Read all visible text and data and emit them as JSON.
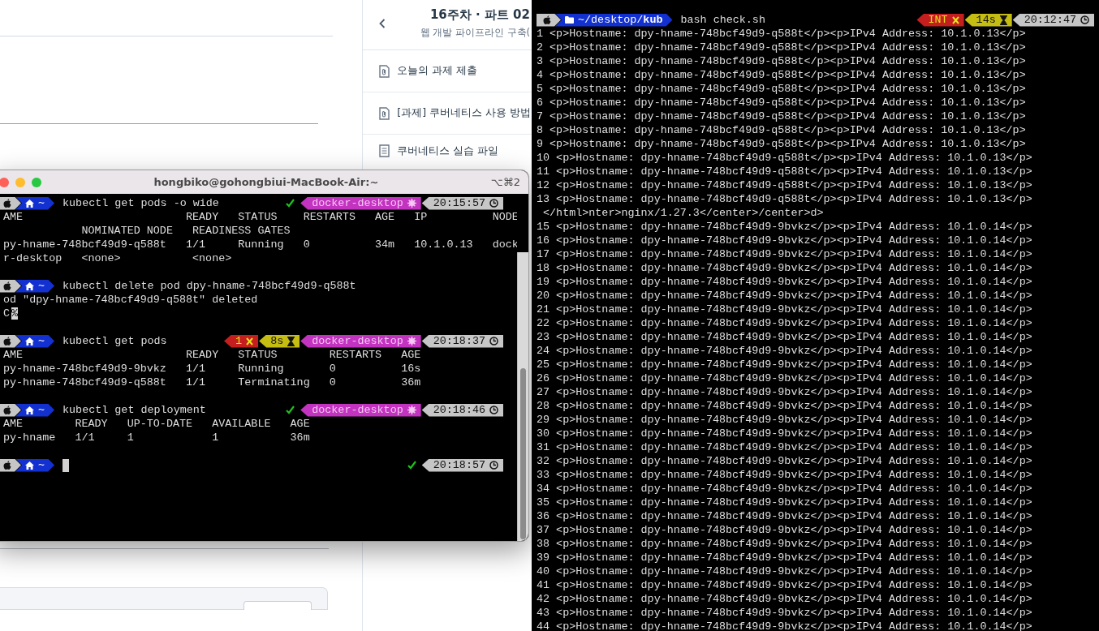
{
  "course_panel": {
    "title": "16주차 · 파트 02",
    "subtitle": "웹 개발 파이프라인 구축(",
    "items": [
      {
        "kind": "attachment",
        "label": "오늘의 과제 제출"
      },
      {
        "kind": "attachment",
        "label": "[과제] 쿠버네티스 사용 방법"
      },
      {
        "kind": "document",
        "label": "쿠버네티스 실습 파일"
      }
    ]
  },
  "terminal_left": {
    "title": "hongbiko@gohongbiui-MacBook-Air:~",
    "shortcut": "⌥⌘2",
    "lines": [
      {
        "kind": "prompt",
        "left": [
          {
            "kind": "apple"
          },
          {
            "kind": "home",
            "path": "~"
          }
        ],
        "command": "kubectl get pods -o wide",
        "cursor": false,
        "right": [
          {
            "kind": "ok"
          },
          {
            "kind": "context",
            "text": "docker-desktop"
          },
          {
            "kind": "time",
            "text": "20:15:57"
          }
        ]
      },
      {
        "kind": "text",
        "text": "AME                         READY   STATUS    RESTARTS   AGE   IP          NODE"
      },
      {
        "kind": "text",
        "text": "            NOMINATED NODE   READINESS GATES"
      },
      {
        "kind": "text",
        "text": "py-hname-748bcf49d9-q588t   1/1     Running   0          34m   10.1.0.13   dock"
      },
      {
        "kind": "text",
        "text": "r-desktop   <none>           <none>"
      },
      {
        "kind": "blank"
      },
      {
        "kind": "prompt",
        "left": [
          {
            "kind": "apple"
          },
          {
            "kind": "home",
            "path": "~"
          }
        ],
        "command": "kubectl delete pod dpy-hname-748bcf49d9-q588t",
        "cursor": false
      },
      {
        "kind": "text",
        "text": "od \"dpy-hname-748bcf49d9-q588t\" deleted"
      },
      {
        "kind": "text",
        "text": "C",
        "marker": "%"
      },
      {
        "kind": "blank"
      },
      {
        "kind": "prompt",
        "left": [
          {
            "kind": "apple"
          },
          {
            "kind": "home",
            "path": "~"
          }
        ],
        "command": "kubectl get pods",
        "cursor": false,
        "right": [
          {
            "kind": "error",
            "text": "1"
          },
          {
            "kind": "duration",
            "text": "8s"
          },
          {
            "kind": "context",
            "text": "docker-desktop"
          },
          {
            "kind": "time",
            "text": "20:18:37"
          }
        ]
      },
      {
        "kind": "text",
        "text": "AME                         READY   STATUS        RESTARTS   AGE"
      },
      {
        "kind": "text",
        "text": "py-hname-748bcf49d9-9bvkz   1/1     Running       0          16s"
      },
      {
        "kind": "text",
        "text": "py-hname-748bcf49d9-q588t   1/1     Terminating   0          36m"
      },
      {
        "kind": "blank"
      },
      {
        "kind": "prompt",
        "left": [
          {
            "kind": "apple"
          },
          {
            "kind": "home",
            "path": "~"
          }
        ],
        "command": "kubectl get deployment",
        "cursor": false,
        "right": [
          {
            "kind": "ok"
          },
          {
            "kind": "context",
            "text": "docker-desktop"
          },
          {
            "kind": "time",
            "text": "20:18:46"
          }
        ]
      },
      {
        "kind": "text",
        "text": "AME        READY   UP-TO-DATE   AVAILABLE   AGE"
      },
      {
        "kind": "text",
        "text": "py-hname   1/1     1            1           36m"
      },
      {
        "kind": "blank"
      },
      {
        "kind": "prompt",
        "left": [
          {
            "kind": "apple"
          },
          {
            "kind": "home",
            "path": "~"
          }
        ],
        "cursor": true,
        "right": [
          {
            "kind": "ok"
          },
          {
            "kind": "time",
            "text": "20:18:57"
          }
        ]
      }
    ]
  },
  "terminal_right": {
    "prompt": {
      "left": [
        {
          "kind": "apple"
        },
        {
          "kind": "folder",
          "path": "~/desktop/**kub**"
        }
      ],
      "command": "bash check.sh",
      "cursor": false,
      "right": [
        {
          "kind": "error",
          "text": "INT"
        },
        {
          "kind": "duration",
          "text": "14s"
        },
        {
          "kind": "time",
          "text": "20:12:47"
        }
      ]
    },
    "lines": [
      "1 <p>Hostname: dpy-hname-748bcf49d9-q588t</p><p>IPv4 Address: 10.1.0.13</p>",
      "2 <p>Hostname: dpy-hname-748bcf49d9-q588t</p><p>IPv4 Address: 10.1.0.13</p>",
      "3 <p>Hostname: dpy-hname-748bcf49d9-q588t</p><p>IPv4 Address: 10.1.0.13</p>",
      "4 <p>Hostname: dpy-hname-748bcf49d9-q588t</p><p>IPv4 Address: 10.1.0.13</p>",
      "5 <p>Hostname: dpy-hname-748bcf49d9-q588t</p><p>IPv4 Address: 10.1.0.13</p>",
      "6 <p>Hostname: dpy-hname-748bcf49d9-q588t</p><p>IPv4 Address: 10.1.0.13</p>",
      "7 <p>Hostname: dpy-hname-748bcf49d9-q588t</p><p>IPv4 Address: 10.1.0.13</p>",
      "8 <p>Hostname: dpy-hname-748bcf49d9-q588t</p><p>IPv4 Address: 10.1.0.13</p>",
      "9 <p>Hostname: dpy-hname-748bcf49d9-q588t</p><p>IPv4 Address: 10.1.0.13</p>",
      "10 <p>Hostname: dpy-hname-748bcf49d9-q588t</p><p>IPv4 Address: 10.1.0.13</p>",
      "11 <p>Hostname: dpy-hname-748bcf49d9-q588t</p><p>IPv4 Address: 10.1.0.13</p>",
      "12 <p>Hostname: dpy-hname-748bcf49d9-q588t</p><p>IPv4 Address: 10.1.0.13</p>",
      "13 <p>Hostname: dpy-hname-748bcf49d9-q588t</p><p>IPv4 Address: 10.1.0.13</p>",
      " </html>nter>nginx/1.27.3</center>/center>d>",
      "15 <p>Hostname: dpy-hname-748bcf49d9-9bvkz</p><p>IPv4 Address: 10.1.0.14</p>",
      "16 <p>Hostname: dpy-hname-748bcf49d9-9bvkz</p><p>IPv4 Address: 10.1.0.14</p>",
      "17 <p>Hostname: dpy-hname-748bcf49d9-9bvkz</p><p>IPv4 Address: 10.1.0.14</p>",
      "18 <p>Hostname: dpy-hname-748bcf49d9-9bvkz</p><p>IPv4 Address: 10.1.0.14</p>",
      "19 <p>Hostname: dpy-hname-748bcf49d9-9bvkz</p><p>IPv4 Address: 10.1.0.14</p>",
      "20 <p>Hostname: dpy-hname-748bcf49d9-9bvkz</p><p>IPv4 Address: 10.1.0.14</p>",
      "21 <p>Hostname: dpy-hname-748bcf49d9-9bvkz</p><p>IPv4 Address: 10.1.0.14</p>",
      "22 <p>Hostname: dpy-hname-748bcf49d9-9bvkz</p><p>IPv4 Address: 10.1.0.14</p>",
      "23 <p>Hostname: dpy-hname-748bcf49d9-9bvkz</p><p>IPv4 Address: 10.1.0.14</p>",
      "24 <p>Hostname: dpy-hname-748bcf49d9-9bvkz</p><p>IPv4 Address: 10.1.0.14</p>",
      "25 <p>Hostname: dpy-hname-748bcf49d9-9bvkz</p><p>IPv4 Address: 10.1.0.14</p>",
      "26 <p>Hostname: dpy-hname-748bcf49d9-9bvkz</p><p>IPv4 Address: 10.1.0.14</p>",
      "27 <p>Hostname: dpy-hname-748bcf49d9-9bvkz</p><p>IPv4 Address: 10.1.0.14</p>",
      "28 <p>Hostname: dpy-hname-748bcf49d9-9bvkz</p><p>IPv4 Address: 10.1.0.14</p>",
      "29 <p>Hostname: dpy-hname-748bcf49d9-9bvkz</p><p>IPv4 Address: 10.1.0.14</p>",
      "30 <p>Hostname: dpy-hname-748bcf49d9-9bvkz</p><p>IPv4 Address: 10.1.0.14</p>",
      "31 <p>Hostname: dpy-hname-748bcf49d9-9bvkz</p><p>IPv4 Address: 10.1.0.14</p>",
      "32 <p>Hostname: dpy-hname-748bcf49d9-9bvkz</p><p>IPv4 Address: 10.1.0.14</p>",
      "33 <p>Hostname: dpy-hname-748bcf49d9-9bvkz</p><p>IPv4 Address: 10.1.0.14</p>",
      "34 <p>Hostname: dpy-hname-748bcf49d9-9bvkz</p><p>IPv4 Address: 10.1.0.14</p>",
      "35 <p>Hostname: dpy-hname-748bcf49d9-9bvkz</p><p>IPv4 Address: 10.1.0.14</p>",
      "36 <p>Hostname: dpy-hname-748bcf49d9-9bvkz</p><p>IPv4 Address: 10.1.0.14</p>",
      "37 <p>Hostname: dpy-hname-748bcf49d9-9bvkz</p><p>IPv4 Address: 10.1.0.14</p>",
      "38 <p>Hostname: dpy-hname-748bcf49d9-9bvkz</p><p>IPv4 Address: 10.1.0.14</p>",
      "39 <p>Hostname: dpy-hname-748bcf49d9-9bvkz</p><p>IPv4 Address: 10.1.0.14</p>",
      "40 <p>Hostname: dpy-hname-748bcf49d9-9bvkz</p><p>IPv4 Address: 10.1.0.14</p>",
      "41 <p>Hostname: dpy-hname-748bcf49d9-9bvkz</p><p>IPv4 Address: 10.1.0.14</p>",
      "42 <p>Hostname: dpy-hname-748bcf49d9-9bvkz</p><p>IPv4 Address: 10.1.0.14</p>",
      "43 <p>Hostname: dpy-hname-748bcf49d9-9bvkz</p><p>IPv4 Address: 10.1.0.14</p>",
      "44 <p>Hostname: dpy-hname-748bcf49d9-9bvkz</p><p>IPv4 Address: 10.1.0.14</p>"
    ]
  }
}
